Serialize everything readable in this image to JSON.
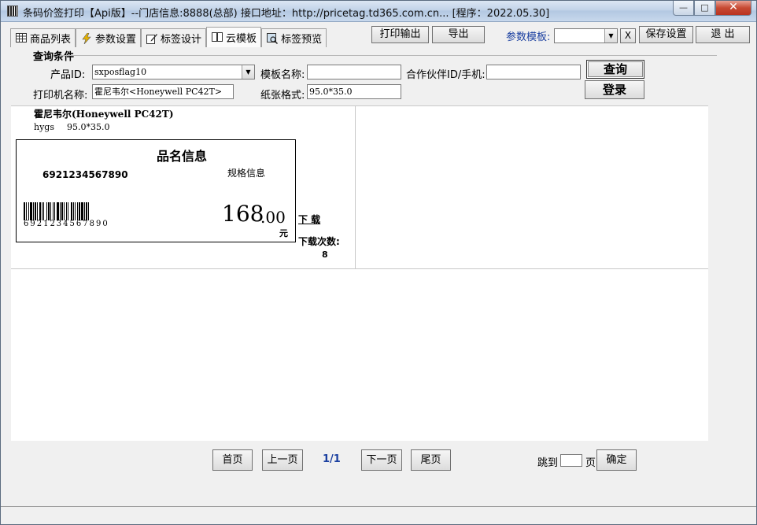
{
  "window": {
    "title": "条码价签打印【Api版】--门店信息:8888(总部) 接口地址：http://pricetag.td365.com.cn... [程序：2022.05.30]",
    "min": "—",
    "max": "□",
    "close": "✕"
  },
  "tabs": [
    {
      "label": "商品列表",
      "icon": "list-icon"
    },
    {
      "label": "参数设置",
      "icon": "bolt-icon"
    },
    {
      "label": "标签设计",
      "icon": "edit-icon"
    },
    {
      "label": "云模板",
      "icon": "book-icon"
    },
    {
      "label": "标签预览",
      "icon": "preview-icon"
    }
  ],
  "toolbar": {
    "print_output": "打印输出",
    "export": "导出",
    "param_template_label": "参数模板:",
    "param_template_value": "",
    "clear": "X",
    "save_settings": "保存设置",
    "exit": "退 出"
  },
  "query": {
    "group_title": "查询条件",
    "product_id_label": "产品ID:",
    "product_id_value": "sxposflag10",
    "template_name_label": "模板名称:",
    "template_name_value": "",
    "partner_label": "合作伙伴ID/手机:",
    "partner_value": "",
    "query_button": "查询",
    "printer_label": "打印机名称:",
    "printer_value": "霍尼韦尔<Honeywell PC42T>",
    "paper_label": "纸张格式:",
    "paper_value": "95.0*35.0",
    "login_button": "登录"
  },
  "template_card": {
    "printer_title": "霍尼韦尔(Honeywell PC42T)",
    "code": "hygs",
    "size": "95.0*35.0",
    "product_name": "品名信息",
    "spec": "规格信息",
    "barcode_number": "6921234567890",
    "barcode_text": "6921234567890",
    "price_int": "168",
    "price_dec": ".00",
    "currency": "元",
    "download": "下 载",
    "download_count_label": "下载次数:",
    "download_count": "8"
  },
  "pager": {
    "first": "首页",
    "prev": "上一页",
    "current": "1/1",
    "next": "下一页",
    "last": "尾页",
    "goto_label": "跳到",
    "goto_value": "",
    "page_unit": "页",
    "confirm": "确定",
    "current_color": "#1a3fa0"
  }
}
